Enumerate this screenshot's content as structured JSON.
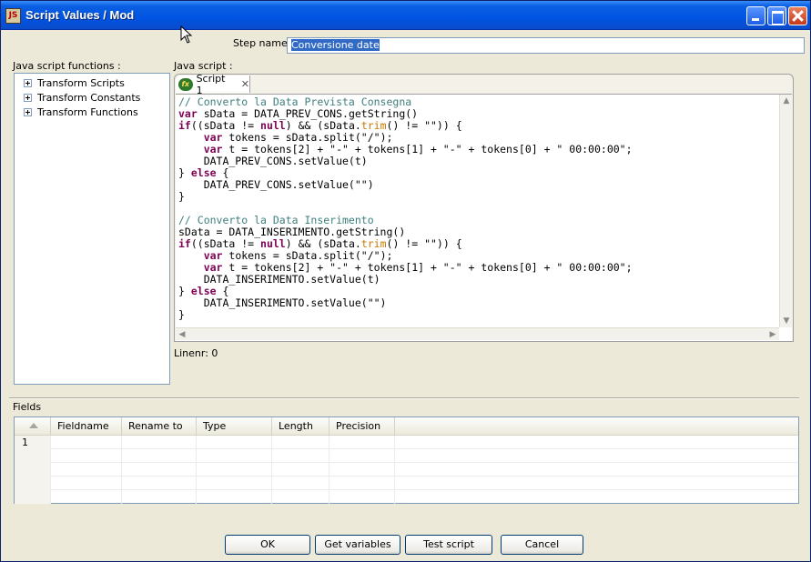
{
  "window": {
    "title": "Script Values / Mod",
    "icon_label": "JS"
  },
  "step": {
    "label": "Step name",
    "value": "Conversione date"
  },
  "functions": {
    "label": "Java script functions :",
    "items": [
      {
        "label": "Transform Scripts"
      },
      {
        "label": "Transform Constants"
      },
      {
        "label": "Transform Functions"
      }
    ]
  },
  "script": {
    "label": "Java script :",
    "tab_label": "Script 1",
    "tab_icon": "fx-script-icon",
    "lines": [
      "// Converto la Data Prevista Consegna",
      "var sData = DATA_PREV_CONS.getString()",
      "if((sData != null) && (sData.trim() != \"\")) {",
      "    var tokens = sData.split(\"/\");",
      "    var t = tokens[2] + \"-\" + tokens[1] + \"-\" + tokens[0] + \" 00:00:00\";",
      "    DATA_PREV_CONS.setValue(t)",
      "} else {",
      "    DATA_PREV_CONS.setValue(\"\")",
      "}",
      "",
      "// Converto la Data Inserimento",
      "sData = DATA_INSERIMENTO.getString()",
      "if((sData != null) && (sData.trim() != \"\")) {",
      "    var tokens = sData.split(\"/\");",
      "    var t = tokens[2] + \"-\" + tokens[1] + \"-\" + tokens[0] + \" 00:00:00\";",
      "    DATA_INSERIMENTO.setValue(t)",
      "} else {",
      "    DATA_INSERIMENTO.setValue(\"\")",
      "}"
    ],
    "linenr": "Linenr: 0"
  },
  "fields": {
    "label": "Fields",
    "columns": [
      "Fieldname",
      "Rename to",
      "Type",
      "Length",
      "Precision"
    ],
    "rows": [
      {
        "num": "1"
      }
    ]
  },
  "buttons": {
    "ok": "OK",
    "get_variables": "Get variables",
    "test_script": "Test script",
    "cancel": "Cancel"
  }
}
